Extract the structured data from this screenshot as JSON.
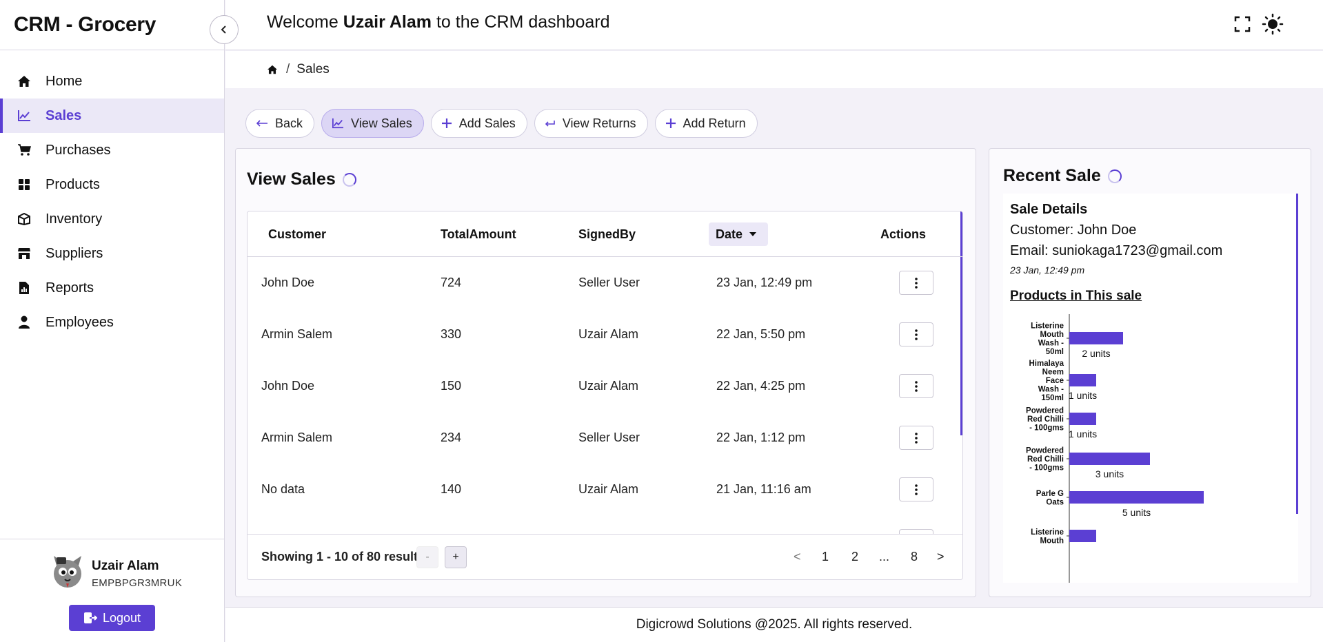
{
  "app": {
    "title": "CRM - Grocery"
  },
  "header": {
    "welcome_prefix": "Welcome",
    "user": "Uzair Alam",
    "welcome_suffix": "to the CRM dashboard"
  },
  "sidebar": {
    "items": [
      {
        "label": "Home",
        "icon": "home-icon"
      },
      {
        "label": "Sales",
        "icon": "chart-line-icon",
        "active": true
      },
      {
        "label": "Purchases",
        "icon": "cart-icon"
      },
      {
        "label": "Products",
        "icon": "grid-icon"
      },
      {
        "label": "Inventory",
        "icon": "box-icon"
      },
      {
        "label": "Suppliers",
        "icon": "store-icon"
      },
      {
        "label": "Reports",
        "icon": "report-icon"
      },
      {
        "label": "Employees",
        "icon": "user-icon"
      }
    ],
    "user": {
      "name": "Uzair Alam",
      "id": "EMPBPGR3MRUK"
    },
    "logout_label": "Logout"
  },
  "breadcrumb": {
    "current": "Sales"
  },
  "actions": {
    "back": "Back",
    "view_sales": "View Sales",
    "add_sales": "Add Sales",
    "view_returns": "View Returns",
    "add_return": "Add Return"
  },
  "sales_table": {
    "title": "View Sales",
    "columns": [
      "Customer",
      "TotalAmount",
      "SignedBy",
      "Date",
      "Actions"
    ],
    "rows": [
      {
        "customer": "John Doe",
        "total": "724",
        "signed_by": "Seller User",
        "date": "23 Jan, 12:49 pm"
      },
      {
        "customer": "Armin Salem",
        "total": "330",
        "signed_by": "Uzair Alam",
        "date": "22 Jan, 5:50 pm"
      },
      {
        "customer": "John Doe",
        "total": "150",
        "signed_by": "Uzair Alam",
        "date": "22 Jan, 4:25 pm"
      },
      {
        "customer": "Armin Salem",
        "total": "234",
        "signed_by": "Seller User",
        "date": "22 Jan, 1:12 pm"
      },
      {
        "customer": "No data",
        "total": "140",
        "signed_by": "Uzair Alam",
        "date": "21 Jan, 11:16 am"
      }
    ],
    "showing": "Showing 1 - 10 of 80 results.",
    "page_minus": "-",
    "page_plus": "+",
    "pagination": [
      "<",
      "1",
      "2",
      "...",
      "8",
      ">"
    ]
  },
  "recent_sale": {
    "title": "Recent Sale",
    "details_title": "Sale Details",
    "customer": "Customer: John Doe",
    "email": "Email: suniokaga1723@gmail.com",
    "date": "23 Jan, 12:49 pm",
    "products_heading": "Products in This sale"
  },
  "chart_data": {
    "type": "bar",
    "orientation": "horizontal",
    "categories": [
      "Listerine Mouth Wash - 50ml",
      "Himalaya Neem Face Wash - 150ml",
      "Powdered Red Chilli - 100gms",
      "Powdered Red Chilli - 100gms",
      "Parle G Oats",
      "Listerine Mouth"
    ],
    "category_lines": [
      [
        "Listerine",
        "Mouth",
        "Wash -",
        "50ml"
      ],
      [
        "Himalaya",
        "Neem",
        "Face",
        "Wash -",
        "150ml"
      ],
      [
        "Powdered",
        "Red Chilli",
        "- 100gms"
      ],
      [
        "Powdered",
        "Red Chilli",
        "- 100gms"
      ],
      [
        "Parle G",
        "Oats"
      ],
      [
        "Listerine",
        "Mouth"
      ]
    ],
    "values": [
      2,
      1,
      1,
      3,
      5,
      1
    ],
    "data_labels": [
      "2 units",
      "1 units",
      "1 units",
      "3 units",
      "5 units",
      ""
    ],
    "bar_color": "#5b3fd3"
  },
  "footer": {
    "text": "Digicrowd Solutions @2025. All rights reserved."
  },
  "colors": {
    "accent": "#5b3fd3",
    "accent_light": "#ebe8f7"
  }
}
